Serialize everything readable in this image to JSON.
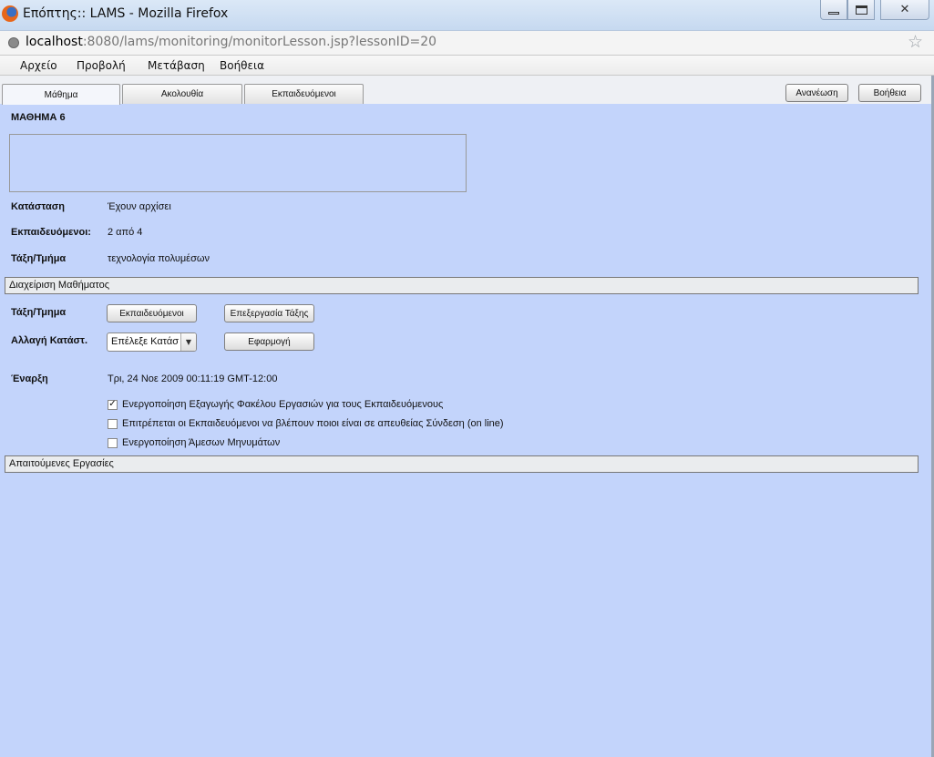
{
  "window": {
    "title": "Επόπτης:: LAMS - Mozilla Firefox"
  },
  "address": {
    "host": "localhost",
    "rest": ":8080/lams/monitoring/monitorLesson.jsp?lessonID=20"
  },
  "menu": {
    "items": [
      "Αρχείο",
      "Προβολή",
      "Μετάβαση",
      "Βοήθεια"
    ]
  },
  "tabs": [
    {
      "label": "Μάθημα",
      "active": true
    },
    {
      "label": "Ακολουθία",
      "active": false
    },
    {
      "label": "Εκπαιδευόμενοι",
      "active": false
    }
  ],
  "toolbar": {
    "refresh_label": "Ανανέωση",
    "help_label": "Βοήθεια"
  },
  "lesson": {
    "title": "ΜΑΘΗΜΑ 6",
    "status_label": "Κατάσταση",
    "status_value": "Έχουν αρχίσει",
    "learners_label": "Εκπαιδευόμενοι:",
    "learners_value": "2 από 4",
    "class_label": "Τάξη/Τμήμα",
    "class_value": "τεχνολογία πολυμέσων"
  },
  "management": {
    "section_title": "Διαχείριση Μαθήματος",
    "class_label": "Τάξη/Τμημα",
    "learners_button": "Εκπαιδευόμενοι",
    "edit_class_button": "Επεξεργασία Τάξης",
    "change_status_label": "Αλλαγή Κατάστ.",
    "status_select_value": "Επέλεξε Κατάσ",
    "apply_button": "Εφαρμογή",
    "start_label": "Έναρξη",
    "start_value": "Τρι, 24 Νοε 2009 00:11:19 GMT-12:00",
    "options": [
      {
        "label": "Ενεργοποίηση Εξαγωγής Φακέλου  Εργασιών για τους Εκπαιδευόμενους",
        "checked": true
      },
      {
        "label": "Επιτρέπεται οι Εκπαιδευόμενοι να βλέπουν ποιοι είναι σε απευθείας Σύνδεση (on line)",
        "checked": false
      },
      {
        "label": "Ενεργοποίηση Άμεσων Μηνυμάτων",
        "checked": false
      }
    ]
  },
  "required_tasks": {
    "section_title": "Απαιτούμενες Εργασίες"
  }
}
